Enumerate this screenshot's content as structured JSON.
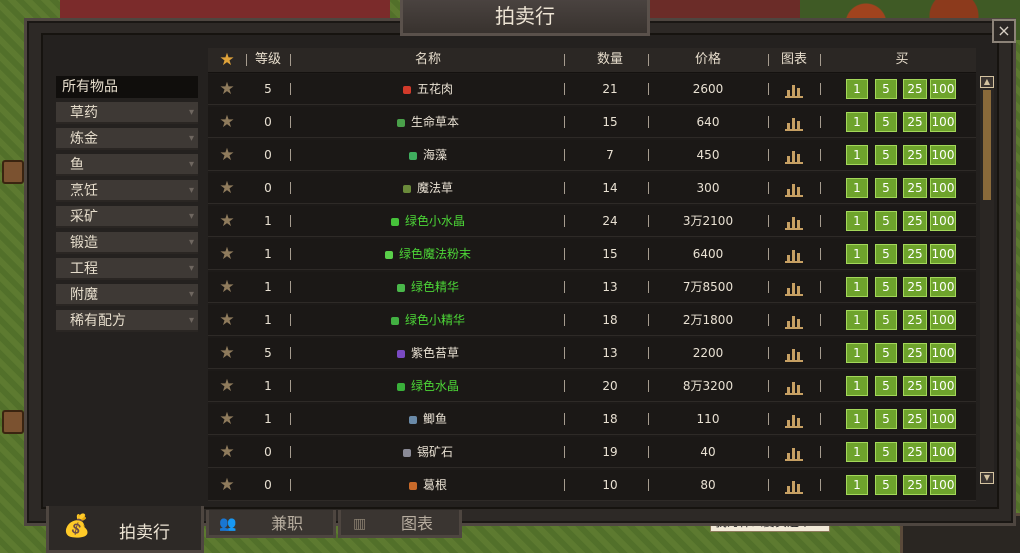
{
  "window": {
    "title": "拍卖行",
    "close_glyph": "×"
  },
  "sidebar": {
    "items": [
      {
        "label": "所有物品",
        "active": true
      },
      {
        "label": "草药",
        "active": false
      },
      {
        "label": "炼金",
        "active": false
      },
      {
        "label": "鱼",
        "active": false
      },
      {
        "label": "烹饪",
        "active": false
      },
      {
        "label": "采矿",
        "active": false
      },
      {
        "label": "锻造",
        "active": false
      },
      {
        "label": "工程",
        "active": false
      },
      {
        "label": "附魔",
        "active": false
      },
      {
        "label": "稀有配方",
        "active": false
      }
    ]
  },
  "table": {
    "headers": {
      "level": "等级",
      "name": "名称",
      "quantity": "数量",
      "price": "价格",
      "chart": "图表",
      "buy": "买"
    },
    "buy_amounts": [
      "1",
      "5",
      "25",
      "100"
    ],
    "rows": [
      {
        "level": "5",
        "name": "五花肉",
        "quantity": "21",
        "price": "2600",
        "green": false,
        "icon_color": "#d23a2a"
      },
      {
        "level": "0",
        "name": "生命草本",
        "quantity": "15",
        "price": "640",
        "green": false,
        "icon_color": "#4aa04a"
      },
      {
        "level": "0",
        "name": "海藻",
        "quantity": "7",
        "price": "450",
        "green": false,
        "icon_color": "#3fae5e"
      },
      {
        "level": "0",
        "name": "魔法草",
        "quantity": "14",
        "price": "300",
        "green": false,
        "icon_color": "#6a8a3a"
      },
      {
        "level": "1",
        "name": "绿色小水晶",
        "quantity": "24",
        "price": "3万2100",
        "green": true,
        "icon_color": "#46c23a"
      },
      {
        "level": "1",
        "name": "绿色魔法粉末",
        "quantity": "15",
        "price": "6400",
        "green": true,
        "icon_color": "#5ad04a"
      },
      {
        "level": "1",
        "name": "绿色精华",
        "quantity": "13",
        "price": "7万8500",
        "green": true,
        "icon_color": "#4ab84a"
      },
      {
        "level": "1",
        "name": "绿色小精华",
        "quantity": "18",
        "price": "2万1800",
        "green": true,
        "icon_color": "#42b042"
      },
      {
        "level": "5",
        "name": "紫色苔草",
        "quantity": "13",
        "price": "2200",
        "green": false,
        "icon_color": "#7a4ac2"
      },
      {
        "level": "1",
        "name": "绿色水晶",
        "quantity": "20",
        "price": "8万3200",
        "green": true,
        "icon_color": "#3ab03a"
      },
      {
        "level": "1",
        "name": "鲫鱼",
        "quantity": "18",
        "price": "110",
        "green": false,
        "icon_color": "#6a8aa8"
      },
      {
        "level": "0",
        "name": "锡矿石",
        "quantity": "19",
        "price": "40",
        "green": false,
        "icon_color": "#8a8a96"
      },
      {
        "level": "0",
        "name": "葛根",
        "quantity": "10",
        "price": "80",
        "green": false,
        "icon_color": "#c86a2a"
      }
    ]
  },
  "tabs": [
    {
      "label": "拍卖行",
      "active": true,
      "icon": "money-bag-icon"
    },
    {
      "label": "兼职",
      "active": false,
      "icon": "people-icon"
    },
    {
      "label": "图表",
      "active": false,
      "icon": "bar-chart-icon"
    }
  ],
  "chat": {
    "text": "我为什么要买这个"
  },
  "colors": {
    "accent_green": "#6ea32c",
    "green_text": "#4cd637",
    "star_active": "#e0a33a",
    "star_inactive": "#8f7b5c"
  }
}
